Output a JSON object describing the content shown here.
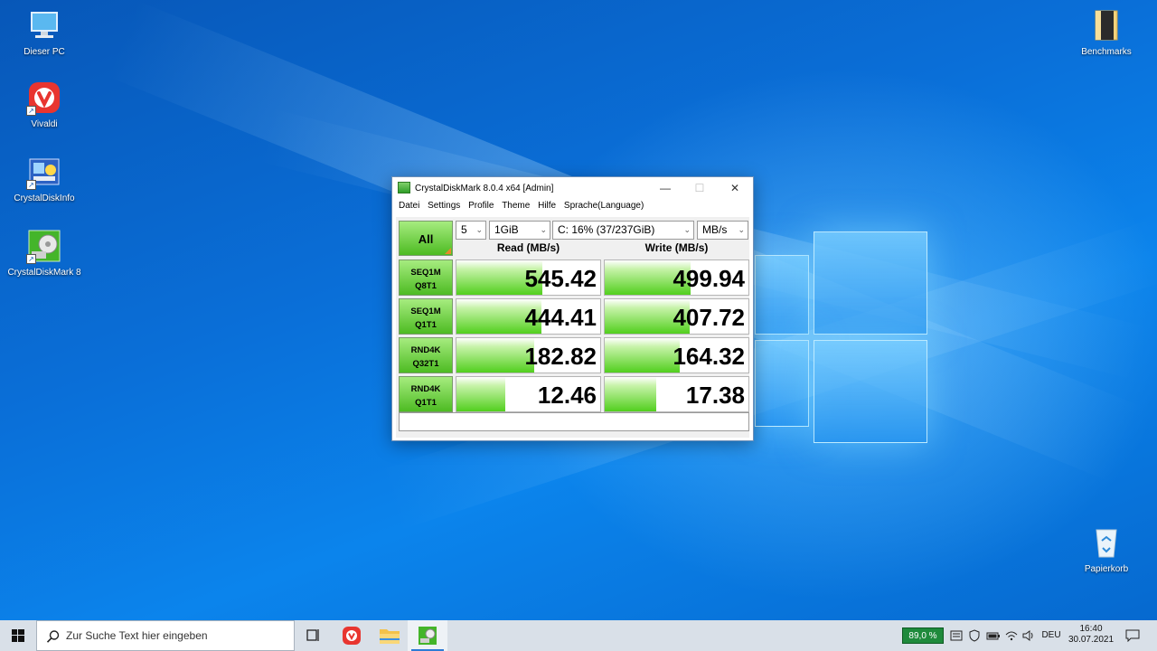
{
  "desktop": {
    "icons_left": [
      {
        "label": "Dieser PC",
        "icon": "computer-icon"
      },
      {
        "label": "Vivaldi",
        "icon": "vivaldi-icon"
      },
      {
        "label": "CrystalDiskInfo",
        "icon": "crystaldiskinfo-icon"
      },
      {
        "label": "CrystalDiskMark 8",
        "icon": "crystaldiskmark-icon"
      }
    ],
    "icons_right": [
      {
        "label": "Benchmarks",
        "icon": "folder-icon"
      },
      {
        "label": "Papierkorb",
        "icon": "recycle-bin-icon"
      }
    ]
  },
  "window": {
    "title": "CrystalDiskMark 8.0.4 x64 [Admin]",
    "controls": {
      "minimize": "—",
      "maximize": "☐",
      "close": "✕"
    },
    "menu": [
      "Datei",
      "Settings",
      "Profile",
      "Theme",
      "Hilfe",
      "Sprache(Language)"
    ],
    "all_button": "All",
    "selects": {
      "count": "5",
      "size": "1GiB",
      "drive": "C: 16% (37/237GiB)",
      "unit": "MB/s"
    },
    "headers": {
      "read": "Read (MB/s)",
      "write": "Write (MB/s)"
    },
    "tests": [
      {
        "line1": "SEQ1M",
        "line2": "Q8T1",
        "read": "545.42",
        "write": "499.94",
        "read_fill": 0.6,
        "write_fill": 0.6
      },
      {
        "line1": "SEQ1M",
        "line2": "Q1T1",
        "read": "444.41",
        "write": "407.72",
        "read_fill": 0.59,
        "write_fill": 0.59
      },
      {
        "line1": "RND4K",
        "line2": "Q32T1",
        "read": "182.82",
        "write": "164.32",
        "read_fill": 0.54,
        "write_fill": 0.52
      },
      {
        "line1": "RND4K",
        "line2": "Q1T1",
        "read": "12.46",
        "write": "17.38",
        "read_fill": 0.34,
        "write_fill": 0.36
      }
    ],
    "comment": ""
  },
  "taskbar": {
    "search_placeholder": "Zur Suche Text hier eingeben",
    "battery": "89,0 %",
    "language": "DEU",
    "time": "16:40",
    "date": "30.07.2021"
  },
  "colors": {
    "bar_green": "#52cf1e",
    "button_green": "#4dbb22",
    "desktop_blue": "#0a6fd8",
    "battery_bg": "#1f8a3c"
  }
}
